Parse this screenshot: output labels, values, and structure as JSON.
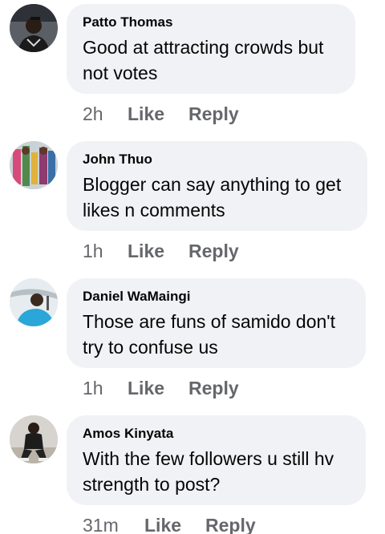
{
  "comments": [
    {
      "author": "Patto Thomas",
      "text": "Good at attracting crowds but\nnot votes",
      "time": "2h",
      "like_label": "Like",
      "reply_label": "Reply",
      "avatar_icon": "profile-photo"
    },
    {
      "author": "John Thuo",
      "text": "Blogger can say anything to get\nlikes n comments",
      "time": "1h",
      "like_label": "Like",
      "reply_label": "Reply",
      "avatar_icon": "profile-photo"
    },
    {
      "author": "Daniel WaMaingi",
      "text": "Those are funs of samido don't\ntry to confuse us",
      "time": "1h",
      "like_label": "Like",
      "reply_label": "Reply",
      "avatar_icon": "profile-photo"
    },
    {
      "author": "Amos Kinyata",
      "text": "With the few followers u still hv\nstrength to post?",
      "time": "31m",
      "like_label": "Like",
      "reply_label": "Reply",
      "avatar_icon": "profile-photo"
    }
  ],
  "colors": {
    "bubble": "#f0f2f5",
    "meta_text": "#65676b",
    "body_text": "#050505"
  }
}
